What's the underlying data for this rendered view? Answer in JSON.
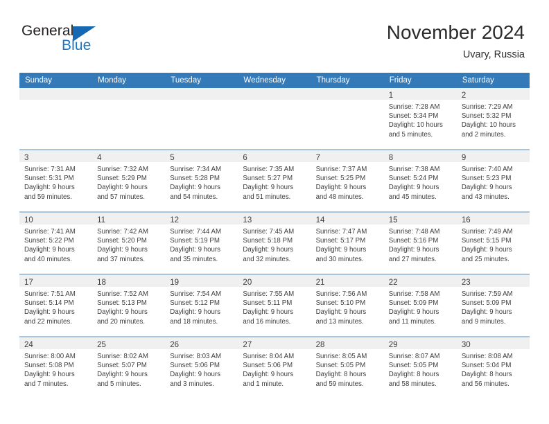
{
  "brand": {
    "word_one": "General",
    "word_two": "Blue",
    "triangle_color": "#1668b0",
    "blue_text_color": "#1b77c4"
  },
  "header": {
    "title": "November 2024",
    "subtitle": "Uvary, Russia",
    "header_bg_color": "#3479b8",
    "divider_color": "#a8c4dd",
    "daynum_band_color": "#f0f0f0"
  },
  "weekday_headers": [
    "Sunday",
    "Monday",
    "Tuesday",
    "Wednesday",
    "Thursday",
    "Friday",
    "Saturday"
  ],
  "weeks": [
    [
      {
        "day": "",
        "sunrise": "",
        "sunset": "",
        "daylight1": "",
        "daylight2": ""
      },
      {
        "day": "",
        "sunrise": "",
        "sunset": "",
        "daylight1": "",
        "daylight2": ""
      },
      {
        "day": "",
        "sunrise": "",
        "sunset": "",
        "daylight1": "",
        "daylight2": ""
      },
      {
        "day": "",
        "sunrise": "",
        "sunset": "",
        "daylight1": "",
        "daylight2": ""
      },
      {
        "day": "",
        "sunrise": "",
        "sunset": "",
        "daylight1": "",
        "daylight2": ""
      },
      {
        "day": "1",
        "sunrise": "Sunrise: 7:28 AM",
        "sunset": "Sunset: 5:34 PM",
        "daylight1": "Daylight: 10 hours",
        "daylight2": "and 5 minutes."
      },
      {
        "day": "2",
        "sunrise": "Sunrise: 7:29 AM",
        "sunset": "Sunset: 5:32 PM",
        "daylight1": "Daylight: 10 hours",
        "daylight2": "and 2 minutes."
      }
    ],
    [
      {
        "day": "3",
        "sunrise": "Sunrise: 7:31 AM",
        "sunset": "Sunset: 5:31 PM",
        "daylight1": "Daylight: 9 hours",
        "daylight2": "and 59 minutes."
      },
      {
        "day": "4",
        "sunrise": "Sunrise: 7:32 AM",
        "sunset": "Sunset: 5:29 PM",
        "daylight1": "Daylight: 9 hours",
        "daylight2": "and 57 minutes."
      },
      {
        "day": "5",
        "sunrise": "Sunrise: 7:34 AM",
        "sunset": "Sunset: 5:28 PM",
        "daylight1": "Daylight: 9 hours",
        "daylight2": "and 54 minutes."
      },
      {
        "day": "6",
        "sunrise": "Sunrise: 7:35 AM",
        "sunset": "Sunset: 5:27 PM",
        "daylight1": "Daylight: 9 hours",
        "daylight2": "and 51 minutes."
      },
      {
        "day": "7",
        "sunrise": "Sunrise: 7:37 AM",
        "sunset": "Sunset: 5:25 PM",
        "daylight1": "Daylight: 9 hours",
        "daylight2": "and 48 minutes."
      },
      {
        "day": "8",
        "sunrise": "Sunrise: 7:38 AM",
        "sunset": "Sunset: 5:24 PM",
        "daylight1": "Daylight: 9 hours",
        "daylight2": "and 45 minutes."
      },
      {
        "day": "9",
        "sunrise": "Sunrise: 7:40 AM",
        "sunset": "Sunset: 5:23 PM",
        "daylight1": "Daylight: 9 hours",
        "daylight2": "and 43 minutes."
      }
    ],
    [
      {
        "day": "10",
        "sunrise": "Sunrise: 7:41 AM",
        "sunset": "Sunset: 5:22 PM",
        "daylight1": "Daylight: 9 hours",
        "daylight2": "and 40 minutes."
      },
      {
        "day": "11",
        "sunrise": "Sunrise: 7:42 AM",
        "sunset": "Sunset: 5:20 PM",
        "daylight1": "Daylight: 9 hours",
        "daylight2": "and 37 minutes."
      },
      {
        "day": "12",
        "sunrise": "Sunrise: 7:44 AM",
        "sunset": "Sunset: 5:19 PM",
        "daylight1": "Daylight: 9 hours",
        "daylight2": "and 35 minutes."
      },
      {
        "day": "13",
        "sunrise": "Sunrise: 7:45 AM",
        "sunset": "Sunset: 5:18 PM",
        "daylight1": "Daylight: 9 hours",
        "daylight2": "and 32 minutes."
      },
      {
        "day": "14",
        "sunrise": "Sunrise: 7:47 AM",
        "sunset": "Sunset: 5:17 PM",
        "daylight1": "Daylight: 9 hours",
        "daylight2": "and 30 minutes."
      },
      {
        "day": "15",
        "sunrise": "Sunrise: 7:48 AM",
        "sunset": "Sunset: 5:16 PM",
        "daylight1": "Daylight: 9 hours",
        "daylight2": "and 27 minutes."
      },
      {
        "day": "16",
        "sunrise": "Sunrise: 7:49 AM",
        "sunset": "Sunset: 5:15 PM",
        "daylight1": "Daylight: 9 hours",
        "daylight2": "and 25 minutes."
      }
    ],
    [
      {
        "day": "17",
        "sunrise": "Sunrise: 7:51 AM",
        "sunset": "Sunset: 5:14 PM",
        "daylight1": "Daylight: 9 hours",
        "daylight2": "and 22 minutes."
      },
      {
        "day": "18",
        "sunrise": "Sunrise: 7:52 AM",
        "sunset": "Sunset: 5:13 PM",
        "daylight1": "Daylight: 9 hours",
        "daylight2": "and 20 minutes."
      },
      {
        "day": "19",
        "sunrise": "Sunrise: 7:54 AM",
        "sunset": "Sunset: 5:12 PM",
        "daylight1": "Daylight: 9 hours",
        "daylight2": "and 18 minutes."
      },
      {
        "day": "20",
        "sunrise": "Sunrise: 7:55 AM",
        "sunset": "Sunset: 5:11 PM",
        "daylight1": "Daylight: 9 hours",
        "daylight2": "and 16 minutes."
      },
      {
        "day": "21",
        "sunrise": "Sunrise: 7:56 AM",
        "sunset": "Sunset: 5:10 PM",
        "daylight1": "Daylight: 9 hours",
        "daylight2": "and 13 minutes."
      },
      {
        "day": "22",
        "sunrise": "Sunrise: 7:58 AM",
        "sunset": "Sunset: 5:09 PM",
        "daylight1": "Daylight: 9 hours",
        "daylight2": "and 11 minutes."
      },
      {
        "day": "23",
        "sunrise": "Sunrise: 7:59 AM",
        "sunset": "Sunset: 5:09 PM",
        "daylight1": "Daylight: 9 hours",
        "daylight2": "and 9 minutes."
      }
    ],
    [
      {
        "day": "24",
        "sunrise": "Sunrise: 8:00 AM",
        "sunset": "Sunset: 5:08 PM",
        "daylight1": "Daylight: 9 hours",
        "daylight2": "and 7 minutes."
      },
      {
        "day": "25",
        "sunrise": "Sunrise: 8:02 AM",
        "sunset": "Sunset: 5:07 PM",
        "daylight1": "Daylight: 9 hours",
        "daylight2": "and 5 minutes."
      },
      {
        "day": "26",
        "sunrise": "Sunrise: 8:03 AM",
        "sunset": "Sunset: 5:06 PM",
        "daylight1": "Daylight: 9 hours",
        "daylight2": "and 3 minutes."
      },
      {
        "day": "27",
        "sunrise": "Sunrise: 8:04 AM",
        "sunset": "Sunset: 5:06 PM",
        "daylight1": "Daylight: 9 hours",
        "daylight2": "and 1 minute."
      },
      {
        "day": "28",
        "sunrise": "Sunrise: 8:05 AM",
        "sunset": "Sunset: 5:05 PM",
        "daylight1": "Daylight: 8 hours",
        "daylight2": "and 59 minutes."
      },
      {
        "day": "29",
        "sunrise": "Sunrise: 8:07 AM",
        "sunset": "Sunset: 5:05 PM",
        "daylight1": "Daylight: 8 hours",
        "daylight2": "and 58 minutes."
      },
      {
        "day": "30",
        "sunrise": "Sunrise: 8:08 AM",
        "sunset": "Sunset: 5:04 PM",
        "daylight1": "Daylight: 8 hours",
        "daylight2": "and 56 minutes."
      }
    ]
  ]
}
